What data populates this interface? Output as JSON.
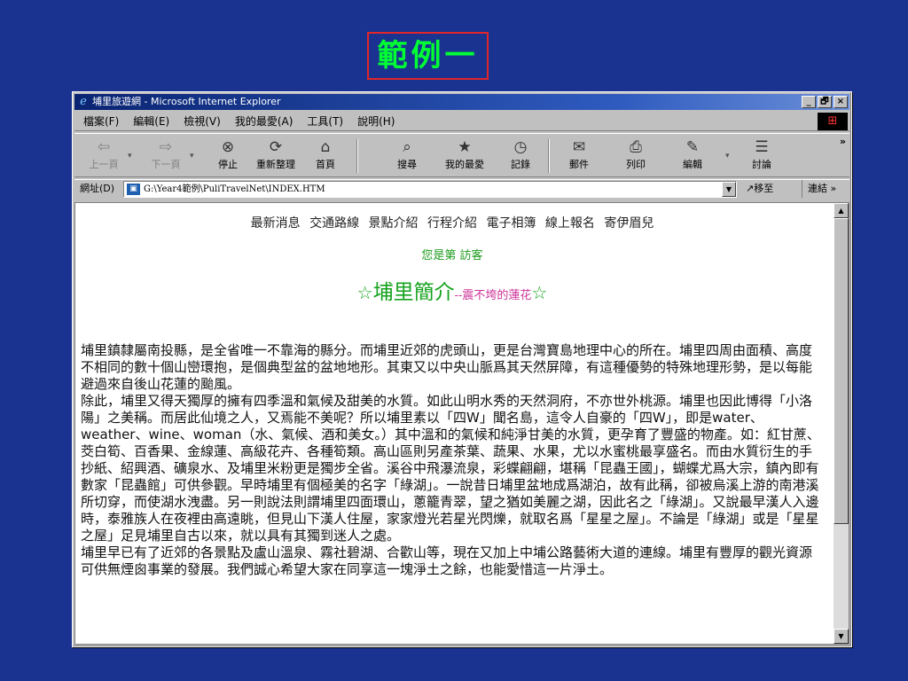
{
  "slide": {
    "title": "範例一"
  },
  "window": {
    "title": "埔里旅遊網 - Microsoft Internet Explorer",
    "min": "_",
    "max": "🗗",
    "close": "×"
  },
  "menu": [
    "檔案(F)",
    "編輯(E)",
    "檢視(V)",
    "我的最愛(A)",
    "工具(T)",
    "說明(H)"
  ],
  "toolbar": {
    "back": "上一頁",
    "forward": "下一頁",
    "stop": "停止",
    "refresh": "重新整理",
    "home": "首頁",
    "search": "搜尋",
    "favorites": "我的最愛",
    "history": "記錄",
    "mail": "郵件",
    "print": "列印",
    "edit": "編輯",
    "discuss": "討論",
    "more": "»"
  },
  "address": {
    "label": "網址(D)",
    "url": "G:\\Year4範例\\PuliTravelNet\\INDEX.HTM",
    "go": "移至",
    "links": "連結 »"
  },
  "page": {
    "nav": [
      "最新消息",
      "交通路線",
      "景點介紹",
      "行程介紹",
      "電子相簿",
      "線上報名",
      "寄伊眉兒"
    ],
    "visitor": "您是第 訪客",
    "heading_star": "☆",
    "heading_main": "埔里簡介",
    "heading_sub": "--震不垮的蓮花",
    "paragraphs": [
      "埔里鎮隸屬南投縣，是全省唯一不靠海的縣分。而埔里近郊的虎頭山，更是台灣寶島地理中心的所在。埔里四周由面積、高度不相同的數十個山巒環抱，是個典型盆的盆地地形。其東又以中央山脈爲其天然屏障，有這種優勢的特殊地理形勢，是以每能避過來自後山花蓮的颱風。",
      "除此，埔里又得天獨厚的擁有四季溫和氣候及甜美的水質。如此山明水秀的天然洞府，不亦世外桃源。埔里也因此博得「小洛陽」之美稱。而居此仙境之人，又焉能不美呢？所以埔里素以「四W」聞名島，這令人自豪的「四W」，即是water、weather、wine、woman（水、氣候、酒和美女。）其中溫和的氣候和純淨甘美的水質，更孕育了豐盛的物產。如：紅甘蔗、茭白筍、百香果、金線蓮、高級花卉、各種筍類。高山區則另產茶葉、蔬果、水果，尤以水蜜桃最享盛名。而由水質衍生的手抄紙、紹興酒、礦泉水、及埔里米粉更是獨步全省。溪谷中飛瀑流泉，彩蝶翩翩，堪稱「昆蟲王國」，蝴蝶尤爲大宗，鎮內即有數家「昆蟲館」可供參觀。早時埔里有個極美的名字「綠湖」。一說昔日埔里盆地成爲湖泊，故有此稱，卻被烏溪上游的南港溪所切穿，而使湖水洩盡。另一則說法則謂埔里四面環山，蔥籠青翠，望之猶如美麗之湖，因此名之「綠湖」。又說最早漢人入邊時，泰雅族人在夜裡由高遠眺，但見山下漢人住屋，家家燈光若星光閃爍，就取名爲「星星之屋」。不論是「綠湖」或是「星星之屋」足見埔里自古以來，就以具有其獨到迷人之處。",
      "埔里早已有了近郊的各景點及盧山溫泉、霧社碧湖、合歡山等，現在又加上中埔公路藝術大道的連線。埔里有豐厚的觀光資源可供無煙囪事業的發展。我們誠心希望大家在同享這一塊淨土之餘，也能愛惜這一片淨土。"
    ]
  }
}
